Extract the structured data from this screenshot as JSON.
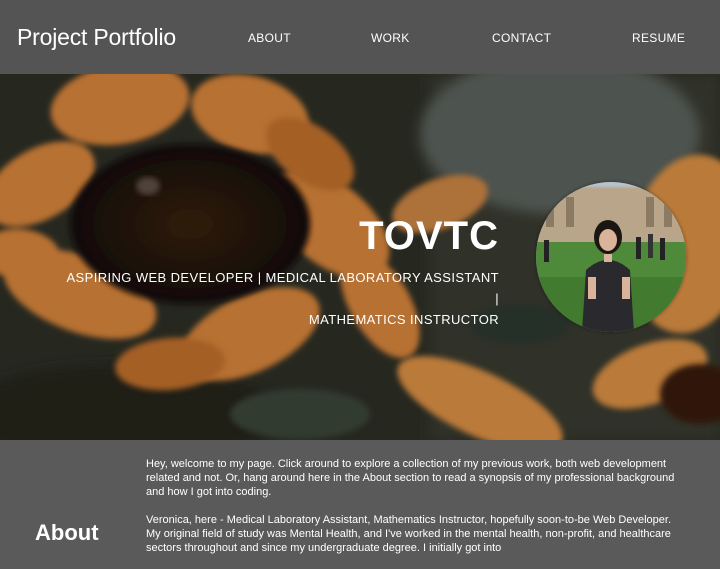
{
  "nav": {
    "brand": "Project Portfolio",
    "links": [
      "ABOUT",
      "WORK",
      "CONTACT",
      "RESUME"
    ]
  },
  "hero": {
    "title": "TOVTC",
    "subtitle_line1": "ASPIRING WEB DEVELOPER | MEDICAL LABORATORY ASSISTANT |",
    "subtitle_line2": "MATHEMATICS INSTRUCTOR"
  },
  "about": {
    "heading": "About",
    "paragraph1": "Hey, welcome to my page. Click around to explore a collection of my previous work, both web development related and not. Or, hang around here in the About section to read a synopsis of my professional background and how I got into coding.",
    "paragraph2": "Veronica, here - Medical Laboratory Assistant, Mathematics Instructor, hopefully soon-to-be Web Developer. My original field of study was Mental Health, and I've worked in the mental health, non-profit, and healthcare sectors throughout and since my undergraduate degree. I initially got into"
  },
  "colors": {
    "navbar": "#545454",
    "page_background": "#5a5a5a",
    "text": "#ffffff",
    "sunflower_petal": "#e08a3c"
  }
}
